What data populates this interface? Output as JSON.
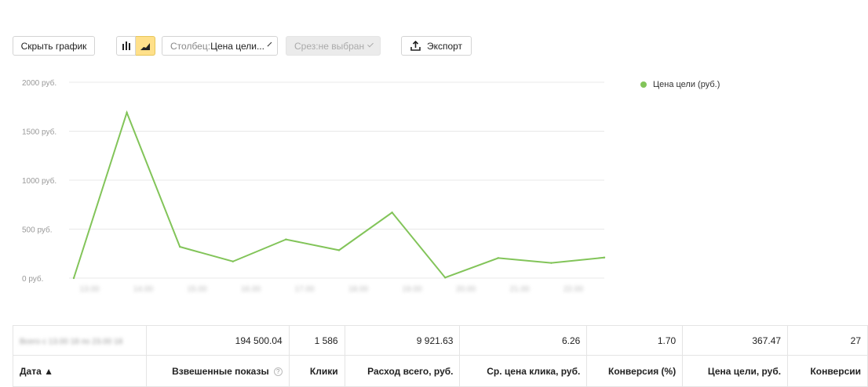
{
  "toolbar": {
    "hide_chart": "Скрыть график",
    "column_label": "Столбец: ",
    "column_value": "Цена цели...",
    "slice_label": "Срез: ",
    "slice_value": "не выбран",
    "export": "Экспорт"
  },
  "chart_data": {
    "type": "line",
    "y_ticks": [
      "0 руб.",
      "500 руб.",
      "1000 руб.",
      "1500 руб.",
      "2000 руб."
    ],
    "ylim": [
      0,
      2000
    ],
    "x_labels": [
      "13.00",
      "14.00",
      "15.00",
      "16.00",
      "17.00",
      "18.00",
      "19.00",
      "20.00",
      "21.00",
      "22.00"
    ],
    "series": [
      {
        "name": "Цена цели (руб.)",
        "color": "#82c459",
        "values": [
          0,
          1690,
          320,
          170,
          395,
          285,
          670,
          5,
          205,
          155,
          210
        ]
      }
    ],
    "grid": true,
    "legend": "top-right"
  },
  "table": {
    "totals": {
      "label": "Всего с 13.00 18 по 23.00 18",
      "values": [
        "194 500.04",
        "1 586",
        "9 921.63",
        "6.26",
        "1.70",
        "367.47",
        "27"
      ]
    },
    "headers": [
      "Дата ▲",
      "Взвешенные показы",
      "Клики",
      "Расход всего, руб.",
      "Ср. цена клика, руб.",
      "Конверсия (%)",
      "Цена цели, руб.",
      "Конверсии"
    ],
    "help": "?"
  }
}
